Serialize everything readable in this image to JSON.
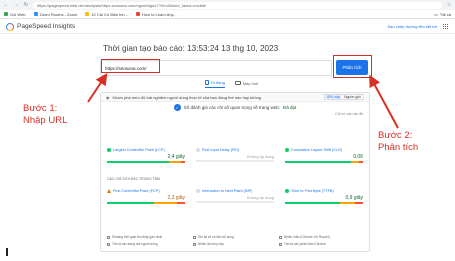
{
  "browser": {
    "url": "https://pagespeed.web.dev/analysis/https-seosona-com/ngxo0dgux7?hl=vi&form_factor=mobile",
    "bookmarks": [
      {
        "label": "Gói Web",
        "color": "#34a853"
      },
      {
        "label": "Zoom Rooms - Zoom",
        "color": "#2d8cff"
      },
      {
        "label": "10 Cái Có Màn hìn...",
        "color": "#fbbc05"
      },
      {
        "label": "How to Learn Any...",
        "color": "#ea4335"
      }
    ],
    "bookmarks_right": "Tất cả"
  },
  "header": {
    "logo_text": "PageSpeed Insights",
    "share_link": "Sao chép đường liên kết tới"
  },
  "main": {
    "title": "Thời gian tạo báo cáo: 13:53:24 13 thg 10, 2023",
    "url_value": "https://seosona.com/",
    "analyze_label": "Phân tích",
    "tabs": [
      {
        "label": "Di động",
        "active": true
      },
      {
        "label": "Máy tính",
        "active": false
      }
    ]
  },
  "card": {
    "head_text": "Khám phá mức độ trải nghiệm người dùng thực tế của bạn đang thế nào hay không",
    "toggle_label": "Nguồn gốc",
    "toggle_options": [
      "URL này",
      "Nguồn gốc"
    ],
    "assessment": "Số đánh giá các chỉ số quan trọng về trang web:",
    "assessment_result": "Đã đạt",
    "expand_link": "Chỉ số các vấn đề",
    "metrics_row1": [
      {
        "label": "Largest Contentful Paint (LCP)",
        "value": "2,4 giây",
        "tone": "green",
        "shape": "circle",
        "color": "#0cce6b",
        "bar": [
          0.8,
          0.15,
          0.05
        ]
      },
      {
        "label": "First Input Delay (FID)",
        "value": "Không áp dụng",
        "tone": "gray",
        "shape": "circle",
        "color": "#dadce0",
        "bar": [
          0,
          0,
          0
        ]
      },
      {
        "label": "Cumulative Layout Shift (CLS)",
        "value": "0,06",
        "tone": "green",
        "shape": "circle",
        "color": "#0cce6b",
        "bar": [
          0.85,
          0.1,
          0.05
        ]
      }
    ],
    "section_label": "CÁC CHỈ SỐ KHÁC TRỌNG TÂM",
    "metrics_row2": [
      {
        "label": "First Contentful Paint (FCP)",
        "value": "2,3 giây",
        "tone": "orange",
        "shape": "triangle",
        "color": "#e37400",
        "bar": [
          0.6,
          0.3,
          0.1
        ]
      },
      {
        "label": "Interaction to Next Paint (INP)",
        "value": "Không áp dụng",
        "tone": "gray",
        "shape": "circle",
        "color": "#dadce0",
        "bar": [
          0,
          0,
          0
        ]
      },
      {
        "label": "Time to First Byte (TTFB)",
        "value": "0,9 giây",
        "tone": "green",
        "shape": "circle",
        "color": "#0cce6b",
        "bar": [
          0.7,
          0.2,
          0.1
        ]
      }
    ],
    "footer_items": [
      "Khoảng thời gian thu thập gần nhất",
      "Ghi lại về số liệu bổ sung",
      "Nhiều mẫu (Chrome UX Report)",
      "Tất cả các trang mà người dùng",
      "Nhiều lần truy cập",
      "Tất cả các phiên bản Chrome"
    ]
  },
  "annotations": {
    "step1": "Bước 1:\nNhập URL",
    "step2": "Bước 2:\nPhân tích"
  },
  "colors": {
    "accent": "#1a73e8",
    "annotation": "#d93025",
    "good": "#0cce6b",
    "needs_improvement": "#ffa400",
    "poor": "#ff4e42"
  }
}
